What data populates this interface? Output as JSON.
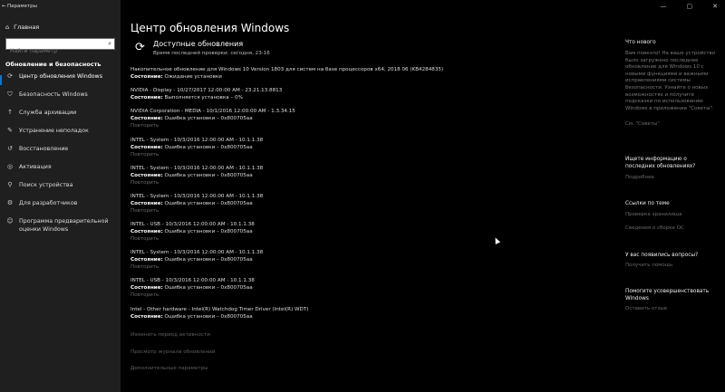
{
  "window": {
    "title": "Параметры",
    "controls": [
      "—",
      "▢",
      "✕"
    ]
  },
  "sidebar": {
    "home": "Главная",
    "search_placeholder": "Найти параметр",
    "section": "Обновление и безопасность",
    "items": [
      {
        "label": "Центр обновления Windows",
        "icon": "sync-icon",
        "active": true
      },
      {
        "label": "Безопасность Windows",
        "icon": "shield-icon"
      },
      {
        "label": "Служба архивации",
        "icon": "backup-icon"
      },
      {
        "label": "Устранение неполадок",
        "icon": "wrench-icon"
      },
      {
        "label": "Восстановление",
        "icon": "recovery-icon"
      },
      {
        "label": "Активация",
        "icon": "activation-icon"
      },
      {
        "label": "Поиск устройства",
        "icon": "find-device-icon"
      },
      {
        "label": "Для разработчиков",
        "icon": "developer-icon"
      },
      {
        "label": "Программа предварительной оценки Windows",
        "icon": "insider-icon"
      }
    ]
  },
  "main": {
    "title": "Центр обновления Windows",
    "status_head": "Доступные обновления",
    "status_sub": "Время последней проверки: сегодня, 23:16",
    "state_label": "Состояние:",
    "retry_label": "Повторить",
    "updates": [
      {
        "name": "Накопительное обновление для Windows 10 Version 1803 для систем на базе процессоров x64, 2018 06 (KB4284835)",
        "status": "Ожидание установки",
        "retry": false
      },
      {
        "name": "NVIDIA - Display - 10/27/2017 12:00:00 AM - 23.21.13.8813",
        "status": "Выполняется установка – 0%",
        "retry": false
      },
      {
        "name": "NVIDIA Corporation - MEDIA - 10/1/2016 12:00:00 AM - 1.3.34.15",
        "status": "Ошибка установки – 0x800705aa",
        "retry": true
      },
      {
        "name": "INTEL - System - 10/3/2016 12:00:00 AM - 10.1.1.38",
        "status": "Ошибка установки – 0x800705aa",
        "retry": true
      },
      {
        "name": "INTEL - System - 10/3/2016 12:00:00 AM - 10.1.1.38",
        "status": "Ошибка установки – 0x800705aa",
        "retry": true
      },
      {
        "name": "INTEL - System - 10/3/2016 12:00:00 AM - 10.1.1.38",
        "status": "Ошибка установки – 0x800705aa",
        "retry": true
      },
      {
        "name": "INTEL - USB - 10/3/2016 12:00:00 AM - 10.1.1.38",
        "status": "Ошибка установки – 0x800705aa",
        "retry": true
      },
      {
        "name": "INTEL - System - 10/3/2016 12:00:00 AM - 10.1.1.38",
        "status": "Ошибка установки – 0x800705aa",
        "retry": true
      },
      {
        "name": "INTEL - USB - 10/3/2016 12:00:00 AM - 10.1.1.38",
        "status": "Ошибка установки – 0x800705aa",
        "retry": true
      },
      {
        "name": "Intel - Other hardware - Intel(R) Watchdog Timer Driver (Intel(R) WDT)",
        "status": "Ошибка установки – 0x800705aa",
        "retry": false
      }
    ],
    "links": [
      "Изменить период активности",
      "Просмотр журнала обновлений",
      "Дополнительные параметры"
    ]
  },
  "right": {
    "whats_new_head": "Что нового",
    "whats_new_text": "Вам повезло! На ваше устройство было загружено последнее обновление для Windows 10 с новыми функциями и важными исправлениями системы безопасности. Узнайте о новых возможностях и получите подсказки по использованию Windows в приложении \"Советы\".",
    "whats_new_link": "См. \"Советы\"",
    "info_head": "Ищете информацию о последних обновлениях?",
    "info_link": "Подробнее",
    "related_head": "Ссылки по теме",
    "related_links": [
      "Проверка хранилища",
      "Сведения о сборке ОС"
    ],
    "questions_head": "У вас появились вопросы?",
    "questions_link": "Получить помощь",
    "improve_head": "Помогите усовершенствовать Windows",
    "improve_link": "Оставить отзыв"
  }
}
